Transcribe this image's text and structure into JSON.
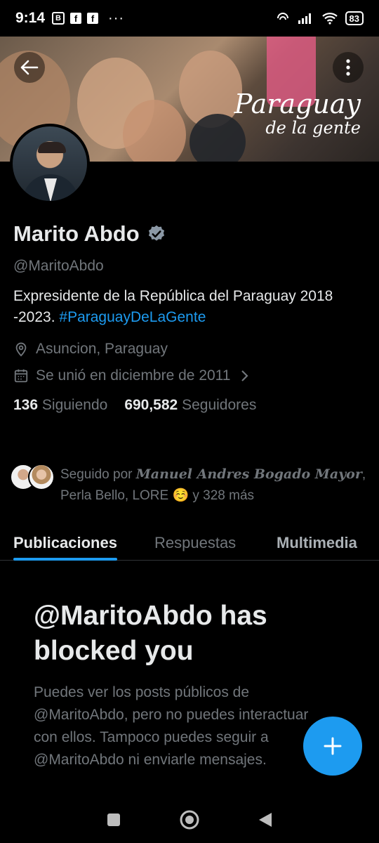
{
  "status_bar": {
    "time": "9:14",
    "notif_glyph": "B",
    "fb1": "f",
    "fb2": "f",
    "more": "···",
    "battery": "83"
  },
  "banner": {
    "line1": "Paraguay",
    "line2": "de la gente"
  },
  "profile": {
    "name": "Marito Abdo",
    "handle": "@MaritoAbdo",
    "bio_text": "Expresidente de la República del Paraguay 2018 -2023. ",
    "bio_hashtag": "#ParaguayDeLaGente",
    "location": "Asuncion, Paraguay",
    "joined": "Se unió en diciembre de 2011",
    "following_count": "136",
    "following_label": "Siguiendo",
    "followers_count": "690,582",
    "followers_label": "Seguidores"
  },
  "followed_by": {
    "prefix": "Seguido por ",
    "name1": "Manuel Andres Bogado Mayor",
    "rest": ", Perla Bello, LORE ☺️ y 328 más"
  },
  "tabs": [
    {
      "label": "Publicaciones"
    },
    {
      "label": "Respuestas"
    },
    {
      "label": "Multimedia"
    }
  ],
  "blocked": {
    "title": "@MaritoAbdo has blocked you",
    "message": "Puedes ver los posts públicos de @MaritoAbdo, pero no puedes interactuar con ellos. Tampoco puedes seguir a @MaritoAbdo ni enviarle mensajes."
  },
  "colors": {
    "accent": "#1d9bf0",
    "background": "#000000",
    "secondary_text": "#71767b"
  }
}
